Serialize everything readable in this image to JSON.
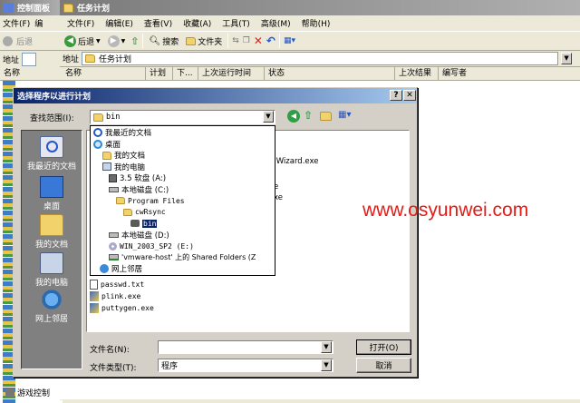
{
  "control_panel": {
    "title": "控制面板",
    "menu": [
      "文件(F)",
      "编"
    ],
    "back_label": "后退",
    "address_label": "地址",
    "name_col": "名称",
    "bottom_item": "游戏控制"
  },
  "scheduled_tasks": {
    "title": "任务计划",
    "menu": [
      "文件(F)",
      "编辑(E)",
      "查看(V)",
      "收藏(A)",
      "工具(T)",
      "高级(M)",
      "帮助(H)"
    ],
    "toolbar": {
      "back": "后退",
      "search": "搜索",
      "folders": "文件夹"
    },
    "address_label": "地址",
    "address_value": "任务计划",
    "columns": [
      "名称",
      "计划",
      "下...",
      "上次运行时间",
      "状态",
      "上次结果",
      "编写者"
    ]
  },
  "dialog": {
    "title": "选择程序以进行计划",
    "lookin_label": "查找范围(I):",
    "lookin_value": "bin",
    "places": [
      {
        "label": "我最近的文档",
        "icon": "recent-docs-icon"
      },
      {
        "label": "桌面",
        "icon": "desktop-icon"
      },
      {
        "label": "我的文档",
        "icon": "my-documents-icon"
      },
      {
        "label": "我的电脑",
        "icon": "my-computer-icon"
      },
      {
        "label": "网上邻居",
        "icon": "network-icon"
      }
    ],
    "dropdown_items": [
      {
        "label": "我最近的文档",
        "indent": 0,
        "icon": "recent-docs-icon",
        "selected": false
      },
      {
        "label": "桌面",
        "indent": 0,
        "icon": "desktop-icon",
        "selected": false
      },
      {
        "label": "我的文档",
        "indent": 1,
        "icon": "my-documents-icon",
        "selected": false
      },
      {
        "label": "我的电脑",
        "indent": 1,
        "icon": "my-computer-icon",
        "selected": false
      },
      {
        "label": "3.5 软盘 (A:)",
        "indent": 2,
        "icon": "floppy-icon",
        "selected": false
      },
      {
        "label": "本地磁盘 (C:)",
        "indent": 2,
        "icon": "drive-icon",
        "selected": false
      },
      {
        "label": "Program Files",
        "indent": 3,
        "icon": "folder-icon",
        "selected": false
      },
      {
        "label": "cwRsync",
        "indent": 4,
        "icon": "folder-icon",
        "selected": false
      },
      {
        "label": "bin",
        "indent": 5,
        "icon": "folder-icon",
        "selected": true
      },
      {
        "label": "本地磁盘 (D:)",
        "indent": 2,
        "icon": "drive-icon",
        "selected": false
      },
      {
        "label": "WIN_2003_SP2 (E:)",
        "indent": 2,
        "icon": "cdrom-icon",
        "selected": false
      },
      {
        "label": "'vmware-host' 上的 Shared Folders (Z",
        "indent": 2,
        "icon": "network-drive-icon",
        "selected": false
      },
      {
        "label": "网上邻居",
        "indent": 1,
        "icon": "network-icon",
        "selected": false
      }
    ],
    "partial_files": [
      ".Wizard.exe",
      "e",
      "xe"
    ],
    "files": [
      {
        "name": "passwd.txt",
        "icon": "text-file-icon"
      },
      {
        "name": "plink.exe",
        "icon": "exe-icon"
      },
      {
        "name": "puttygen.exe",
        "icon": "exe-icon"
      }
    ],
    "filename_label": "文件名(N):",
    "filename_value": "",
    "filetype_label": "文件类型(T):",
    "filetype_value": "程序",
    "open_button": "打开(O)",
    "cancel_button": "取消"
  },
  "watermark": "www.osyunwei.com"
}
